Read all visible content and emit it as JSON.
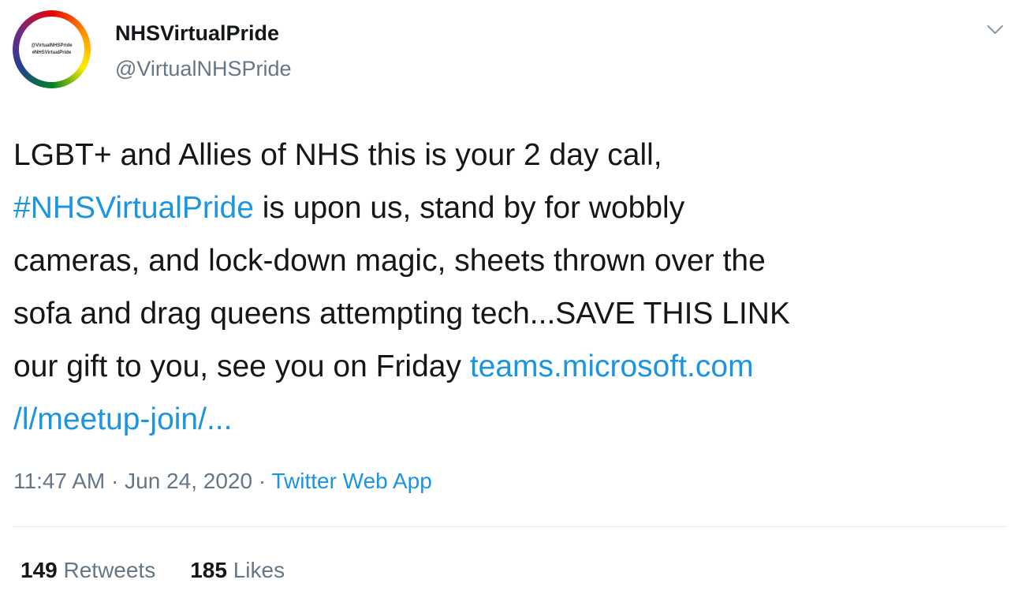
{
  "author": {
    "display_name": "NHSVirtualPride",
    "handle": "@VirtualNHSPride",
    "avatar_text_1": "@VirtualNHSPride",
    "avatar_text_2": "#NHSVirtualPride"
  },
  "tweet": {
    "line1": "LGBT+ and Allies of NHS this is your 2 day call,",
    "hashtag": "#NHSVirtualPride",
    "line2_rest": " is upon us, stand by for wobbly",
    "line3": "cameras, and lock-down magic, sheets thrown over the",
    "line4": "sofa and drag queens attempting tech...SAVE THIS LINK",
    "line5_text": "our gift to you, see you on Friday ",
    "link_part1": "teams.microsoft.com",
    "link_part2": "/l/meetup-join/..."
  },
  "meta": {
    "time": "11:47 AM",
    "separator": " · ",
    "date": "Jun 24, 2020",
    "source": "Twitter Web App"
  },
  "stats": {
    "retweets_count": "149",
    "retweets_label": " Retweets",
    "likes_count": "185",
    "likes_label": " Likes"
  },
  "icons": {
    "caret": "chevron-down-icon"
  },
  "colors": {
    "link": "#1b95e0",
    "text": "#14171a",
    "secondary": "#657786",
    "divider": "#e6ecf0"
  }
}
